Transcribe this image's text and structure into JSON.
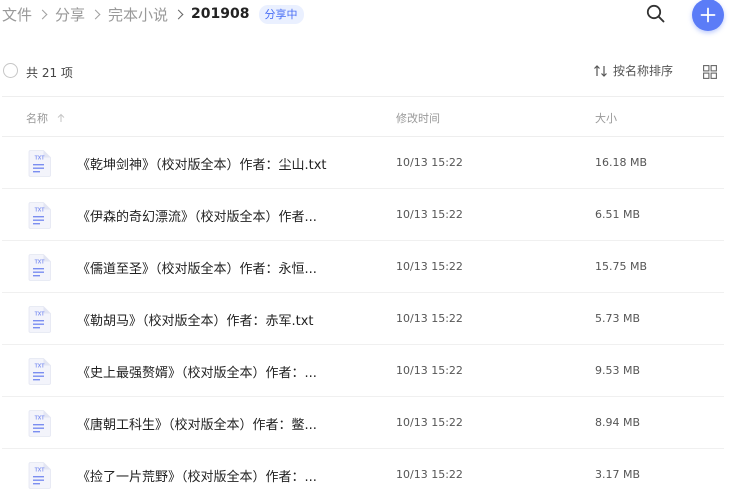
{
  "breadcrumb": [
    {
      "label": "文件"
    },
    {
      "label": "分享"
    },
    {
      "label": "完本小说"
    },
    {
      "label": "201908"
    }
  ],
  "share_badge": "分享中",
  "summary": {
    "count_label": "共 21 项",
    "sort_label": "按名称排序"
  },
  "columns": {
    "name": "名称",
    "modified": "修改时间",
    "size": "大小"
  },
  "files": [
    {
      "name": "《乾坤剑神》（校对版全本）作者：尘山.txt",
      "modified": "10/13 15:22",
      "size": "16.18 MB",
      "icon": "txt-file-icon"
    },
    {
      "name": "《伊森的奇幻漂流》（校对版全本）作者...",
      "modified": "10/13 15:22",
      "size": "6.51 MB",
      "icon": "txt-file-icon"
    },
    {
      "name": "《儒道至圣》（校对版全本）作者：永恒...",
      "modified": "10/13 15:22",
      "size": "15.75 MB",
      "icon": "txt-file-icon"
    },
    {
      "name": "《勒胡马》（校对版全本）作者：赤军.txt",
      "modified": "10/13 15:22",
      "size": "5.73 MB",
      "icon": "txt-file-icon"
    },
    {
      "name": "《史上最强赘婿》（校对版全本）作者：...",
      "modified": "10/13 15:22",
      "size": "9.53 MB",
      "icon": "txt-file-icon"
    },
    {
      "name": "《唐朝工科生》（校对版全本）作者：鳖...",
      "modified": "10/13 15:22",
      "size": "8.94 MB",
      "icon": "txt-file-icon"
    },
    {
      "name": "《捡了一片荒野》（校对版全本）作者：...",
      "modified": "10/13 15:22",
      "size": "3.17 MB",
      "icon": "txt-file-icon"
    }
  ],
  "icon_text": "TXT",
  "colors": {
    "accent": "#5b7cf7",
    "badge_bg": "#eaf0ff",
    "badge_text": "#4a6ef5"
  }
}
